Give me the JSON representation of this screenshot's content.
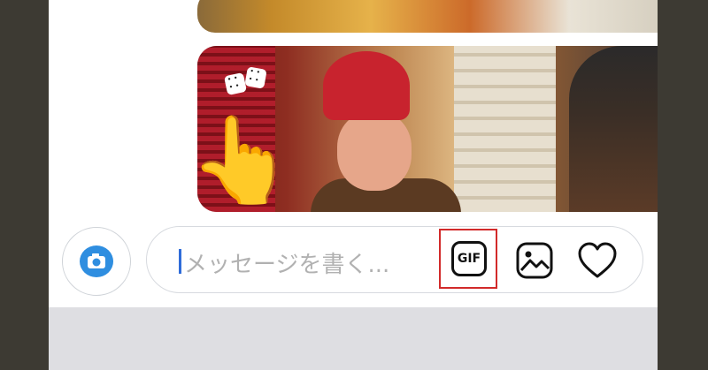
{
  "composer": {
    "placeholder": "メッセージを書く...",
    "gif_label": "GIF"
  },
  "icons": {
    "camera": "camera-icon",
    "gif": "gif-icon",
    "photo": "photo-icon",
    "heart": "heart-icon",
    "pointer": "pointing-hand-icon",
    "dice": "dice-icon"
  },
  "colors": {
    "camera_blue": "#2f8ee0",
    "highlight_red": "#d22a2a",
    "cursor_blue": "#2f6cd9",
    "placeholder_gray": "#b1b1b1"
  }
}
